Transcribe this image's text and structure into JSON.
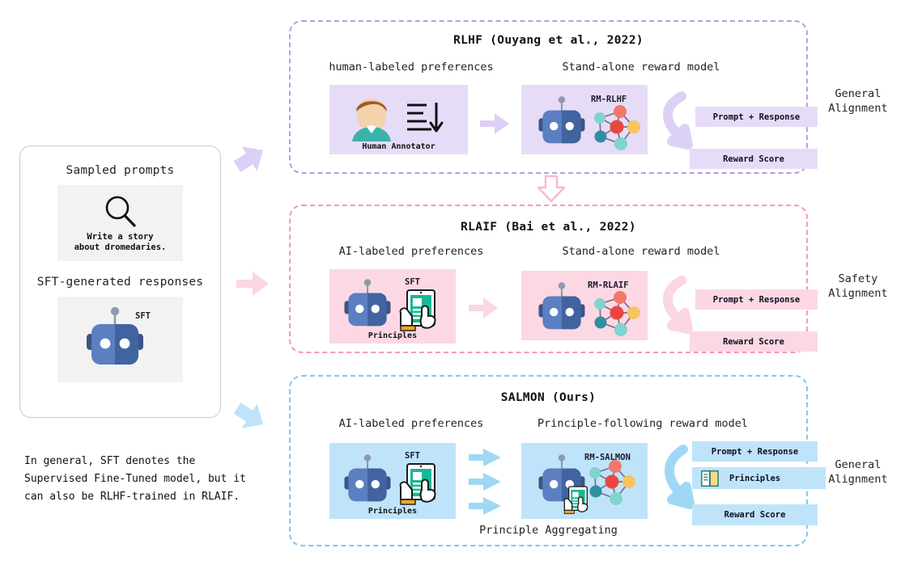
{
  "colors": {
    "purple_border": "#b79de0",
    "purple_fill": "#e7dcf7",
    "pink_border": "#f49ab4",
    "pink_fill": "#fcd8e4",
    "blue_border": "#7ec9ef",
    "blue_fill": "#bfe4fa",
    "robot_body": "#5b7fc0",
    "robot_body_dark": "#41639f",
    "card_border": "#c9c9c9",
    "gray_box": "#f2f2f2"
  },
  "input_card": {
    "prompts_title": "Sampled prompts",
    "prompt_icon": "magnifier-icon",
    "prompt_text": "Write a story\nabout dromedaries.",
    "responses_title": "SFT-generated responses",
    "sft_tag": "SFT",
    "robot_icon": "robot-icon"
  },
  "footnote": "In general, SFT denotes the\nSupervised Fine-Tuned model, but it\ncan also be RLHF-trained in RLAIF.",
  "panels": [
    {
      "id": "rlhf",
      "title": "RLHF (Ouyang et al., 2022)",
      "left_label": "human-labeled preferences",
      "right_label": "Stand-alone reward model",
      "left_tile_caption": "Human Annotator",
      "left_tile_icon": "human-annotator-icon",
      "rm_tag": "RM-RLHF",
      "chips": [
        "Prompt + Response",
        "Reward Score"
      ],
      "align_label": "General\nAlignment"
    },
    {
      "id": "rlaif",
      "title": "RLAIF (Bai et al., 2022)",
      "left_label": "AI-labeled preferences",
      "right_label": "Stand-alone reward model",
      "left_tile_tag": "SFT",
      "left_tile_caption": "Principles",
      "rm_tag": "RM-RLAIF",
      "chips": [
        "Prompt + Response",
        "Reward Score"
      ],
      "align_label": "Safety\nAlignment"
    },
    {
      "id": "salmon",
      "title": "SALMON (Ours)",
      "left_label": "AI-labeled preferences",
      "right_label": "Principle-following reward model",
      "left_tile_tag": "SFT",
      "left_tile_caption": "Principles",
      "rm_tag": "RM-SALMON",
      "chips": [
        "Prompt + Response",
        "Principles",
        "Reward Score"
      ],
      "chip_icon": "book-icon",
      "bottom_label": "Principle Aggregating",
      "align_label": "General\nAlignment"
    }
  ],
  "connectors": {
    "to_rlhf": "arrow-up-right",
    "to_rlaif": "arrow-right",
    "to_salmon": "arrow-down-right",
    "rlhf_to_rlaif": "arrow-down-outline"
  }
}
